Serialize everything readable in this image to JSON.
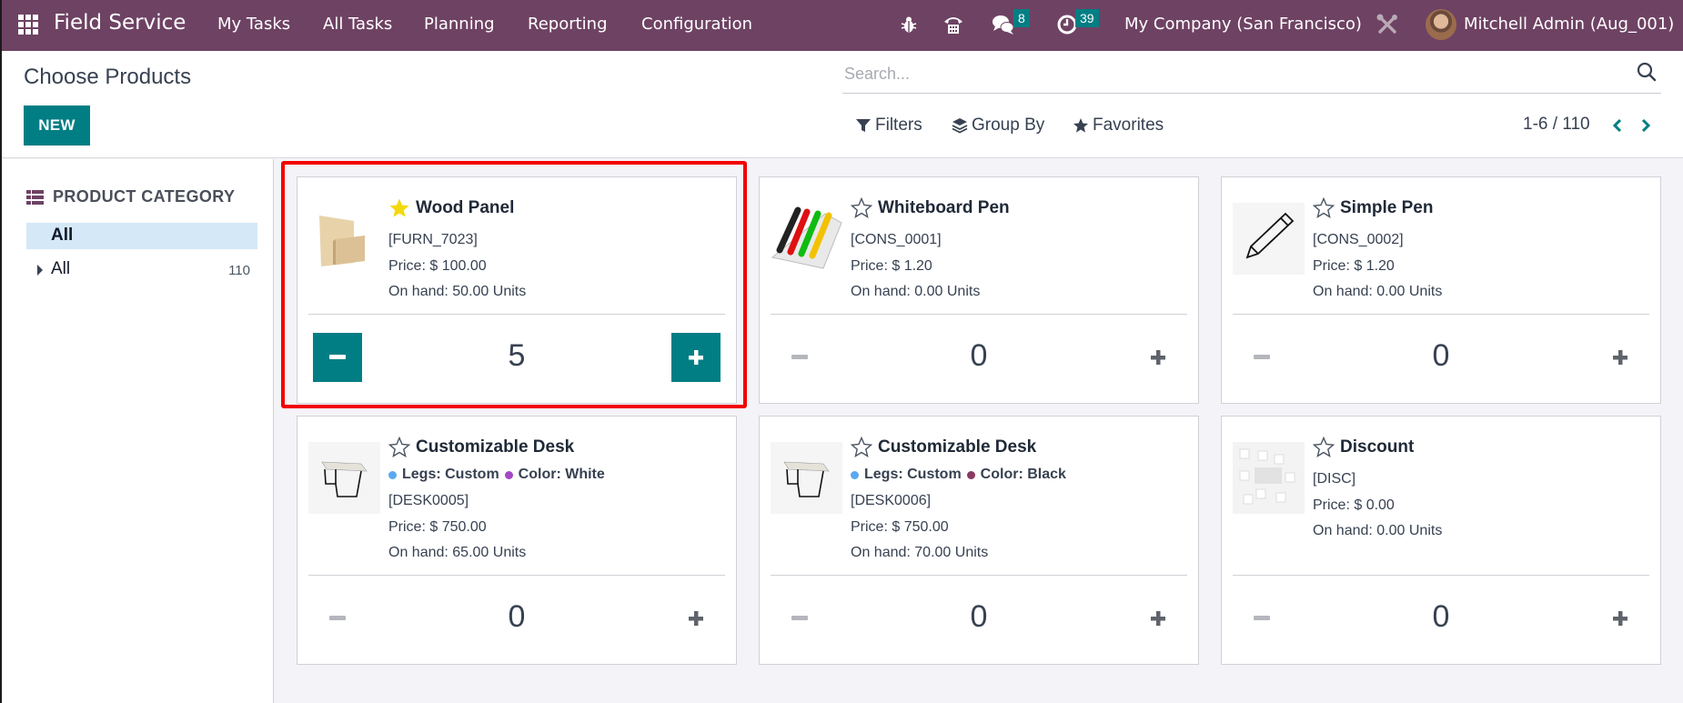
{
  "navbar": {
    "app_name": "Field Service",
    "menus": [
      "My Tasks",
      "All Tasks",
      "Planning",
      "Reporting",
      "Configuration"
    ],
    "messages_badge": "8",
    "activities_badge": "39",
    "company": "My Company (San Francisco)",
    "user": "Mitchell Admin (Aug_001)",
    "icons": {
      "apps": "grid-icon",
      "debug": "bug-icon",
      "phone": "phone-icon",
      "messages": "chat-icon",
      "activities": "clock-icon",
      "settings": "tools-icon"
    },
    "colors": {
      "bar": "#6e4263",
      "badge": "#017e84"
    }
  },
  "control_panel": {
    "title": "Choose Products",
    "new_label": "NEW",
    "search_placeholder": "Search...",
    "search_value": "",
    "filters_label": "Filters",
    "group_by_label": "Group By",
    "favorites_label": "Favorites",
    "pager_value": "1-6 / 110"
  },
  "sidebar": {
    "header": "PRODUCT CATEGORY",
    "active_item": "All",
    "items": [
      {
        "label": "All",
        "count": "110"
      }
    ]
  },
  "products": [
    {
      "name": "Wood Panel",
      "favorite": true,
      "attributes": [],
      "code": "[FURN_7023]",
      "price": "Price: $ 100.00",
      "on_hand": "On hand: 50.00 Units",
      "quantity": "5",
      "image": "wood-panel"
    },
    {
      "name": "Whiteboard Pen",
      "favorite": false,
      "attributes": [],
      "code": "[CONS_0001]",
      "price": "Price: $ 1.20",
      "on_hand": "On hand: 0.00 Units",
      "quantity": "0",
      "image": "whiteboard-pen"
    },
    {
      "name": "Simple Pen",
      "favorite": false,
      "attributes": [],
      "code": "[CONS_0002]",
      "price": "Price: $ 1.20",
      "on_hand": "On hand: 0.00 Units",
      "quantity": "0",
      "image": "pencil"
    },
    {
      "name": "Customizable Desk",
      "favorite": false,
      "attributes": [
        {
          "label": "Legs: Custom",
          "color": "#5aa9f0"
        },
        {
          "label": "Color: White",
          "color": "#a447c4"
        }
      ],
      "code": "[DESK0005]",
      "price": "Price: $ 750.00",
      "on_hand": "On hand: 65.00 Units",
      "quantity": "0",
      "image": "desk"
    },
    {
      "name": "Customizable Desk",
      "favorite": false,
      "attributes": [
        {
          "label": "Legs: Custom",
          "color": "#5aa9f0"
        },
        {
          "label": "Color: Black",
          "color": "#8a3a5e"
        }
      ],
      "code": "[DESK0006]",
      "price": "Price: $ 750.00",
      "on_hand": "On hand: 70.00 Units",
      "quantity": "0",
      "image": "desk"
    },
    {
      "name": "Discount",
      "favorite": false,
      "attributes": [],
      "code": "[DISC]",
      "price": "Price: $ 0.00",
      "on_hand": "On hand: 0.00 Units",
      "quantity": "0",
      "image": "placeholder"
    }
  ],
  "highlight": {
    "product_index": 0,
    "color": "#f20000"
  }
}
